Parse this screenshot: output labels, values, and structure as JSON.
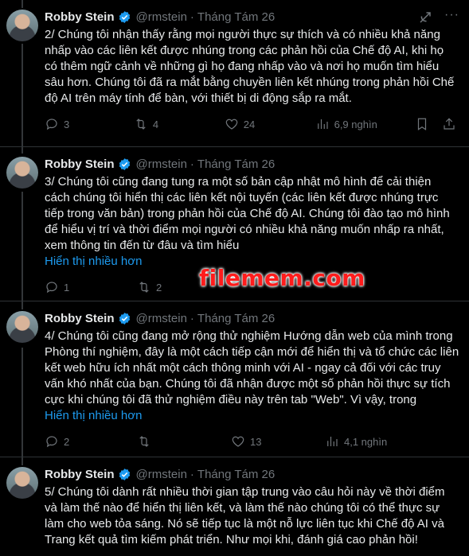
{
  "author": {
    "name": "Robby Stein",
    "handle": "@rmstein",
    "date": "Tháng Tám 26"
  },
  "tweets": [
    {
      "text": "2/ Chúng tôi nhận thấy rằng mọi người thực sự thích và có nhiều khả năng nhấp vào các liên kết được nhúng trong các phản hồi của Chế độ AI, khi họ có thêm ngữ cảnh về những gì họ đang nhấp vào và nơi họ muốn tìm hiểu sâu hơn. Chúng tôi đã ra mắt bằng chuyền liên kết nhúng trong phản hồi Chế độ AI trên máy tính để bàn, với thiết bị di động sắp ra mắt.",
      "show_more": "",
      "replies": "3",
      "reposts": "4",
      "likes": "24",
      "views": "6,9 nghìn"
    },
    {
      "text": "3/ Chúng tôi cũng đang tung ra một số bản cập nhật mô hình để cải thiện cách chúng tôi hiển thị các liên kết nội tuyến (các liên kết được nhúng trực tiếp trong văn bản) trong phản hồi của Chế độ AI. Chúng tôi đào tạo mô hình để hiểu vị trí và thời điểm mọi người có nhiều khả năng muốn nhấp ra nhất, xem thông tin đến từ đâu và tìm hiểu",
      "show_more": "Hiển thị nhiều hơn",
      "replies": "1",
      "reposts": "2",
      "likes": "",
      "views": ""
    },
    {
      "text": "4/ Chúng tôi cũng đang mở rộng thử nghiệm Hướng dẫn web của mình trong Phòng thí nghiệm, đây là một cách tiếp cận mới để hiển thị và tổ chức các liên kết web hữu ích nhất một cách thông minh với AI - ngay cả đối với các truy vấn khó nhất của bạn. Chúng tôi đã nhận được một số phản hồi thực sự tích cực khi chúng tôi đã thử nghiệm điều này trên tab \"Web\". Vì vậy, trong",
      "show_more": "Hiển thị nhiều hơn",
      "replies": "2",
      "reposts": "",
      "likes": "13",
      "views": "4,1 nghìn"
    },
    {
      "text": "5/ Chúng tôi dành rất nhiều thời gian tập trung vào câu hỏi này về thời điểm và làm thế nào để hiển thị liên kết, và làm thế nào chúng tôi có thể thực sự làm cho web tỏa sáng. Nó sẽ tiếp tục là một nỗ lực liên tục khi Chế độ AI và Trang kết quả tìm kiếm phát triển. Như mọi khi, đánh giá cao phản hồi!",
      "show_more": "",
      "replies": "",
      "reposts": "",
      "likes": "",
      "views": ""
    }
  ],
  "watermark": "filemem.com",
  "colors": {
    "background": "#000000",
    "text": "#e7e9ea",
    "muted": "#71767b",
    "accent": "#1d9bf0",
    "verified": "#1d9bf0"
  }
}
